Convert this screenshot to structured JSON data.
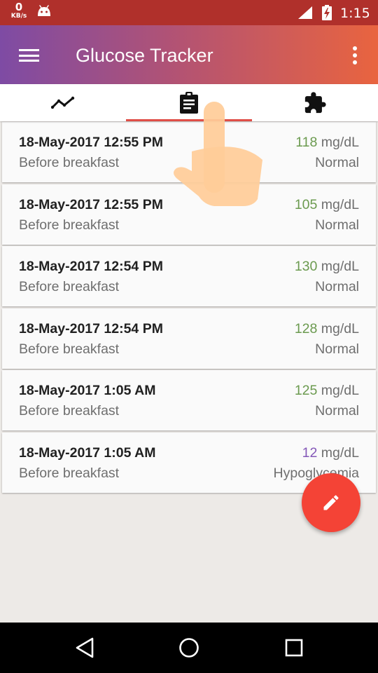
{
  "status_bar": {
    "net_speed_value": "0",
    "net_speed_unit": "KB/s",
    "time": "1:15",
    "icons": [
      "android-icon",
      "signal-icon",
      "battery-charging-icon"
    ]
  },
  "app_bar": {
    "title": "Glucose Tracker",
    "icons": [
      "menu-icon",
      "more-vert-icon"
    ],
    "gradient": [
      "#7e4ba4",
      "#b45372",
      "#e9643f"
    ]
  },
  "tabs": {
    "items": [
      "chart-tab",
      "log-tab",
      "extensions-tab"
    ],
    "icons": [
      "trend-icon",
      "clipboard-icon",
      "puzzle-icon"
    ],
    "selected_index": 1,
    "indicator_color": "#e04e47"
  },
  "readings": [
    {
      "date": "18-May-2017 12:55 PM",
      "meal": "Before breakfast",
      "value": "118",
      "unit": "mg/dL",
      "status": "Normal",
      "value_color": "#6b9a4f"
    },
    {
      "date": "18-May-2017 12:55 PM",
      "meal": "Before breakfast",
      "value": "105",
      "unit": "mg/dL",
      "status": "Normal",
      "value_color": "#6b9a4f"
    },
    {
      "date": "18-May-2017 12:54 PM",
      "meal": "Before breakfast",
      "value": "130",
      "unit": "mg/dL",
      "status": "Normal",
      "value_color": "#6b9a4f"
    },
    {
      "date": "18-May-2017 12:54 PM",
      "meal": "Before breakfast",
      "value": "128",
      "unit": "mg/dL",
      "status": "Normal",
      "value_color": "#6b9a4f"
    },
    {
      "date": "18-May-2017 1:05 AM",
      "meal": "Before breakfast",
      "value": "125",
      "unit": "mg/dL",
      "status": "Normal",
      "value_color": "#6b9a4f"
    },
    {
      "date": "18-May-2017 1:05 AM",
      "meal": "Before breakfast",
      "value": "12",
      "unit": "mg/dL",
      "status": "Hypoglycemia",
      "value_color": "#8458b8"
    }
  ],
  "fab": {
    "icon": "pencil-icon",
    "color": "#f44336"
  },
  "overlay": {
    "icon": "pointing-hand-icon"
  },
  "nav_bar": {
    "icons": [
      "back-icon",
      "home-icon",
      "recents-icon"
    ]
  }
}
